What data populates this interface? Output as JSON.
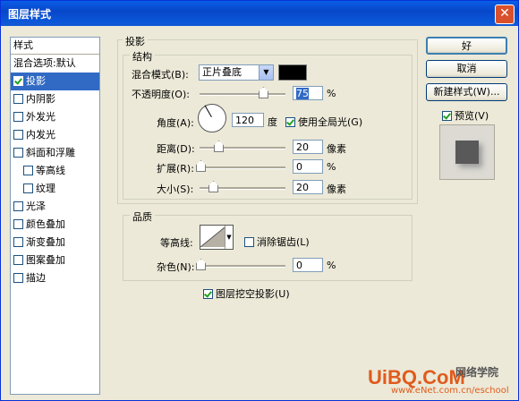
{
  "window": {
    "title": "图层样式",
    "close_label": "✕"
  },
  "sidebar": {
    "header": "样式",
    "items": [
      {
        "label": "混合选项:默认",
        "checkbox": false,
        "checked": false,
        "sub": false,
        "selected": false
      },
      {
        "label": "投影",
        "checkbox": true,
        "checked": true,
        "sub": false,
        "selected": true
      },
      {
        "label": "内阴影",
        "checkbox": true,
        "checked": false,
        "sub": false,
        "selected": false
      },
      {
        "label": "外发光",
        "checkbox": true,
        "checked": false,
        "sub": false,
        "selected": false
      },
      {
        "label": "内发光",
        "checkbox": true,
        "checked": false,
        "sub": false,
        "selected": false
      },
      {
        "label": "斜面和浮雕",
        "checkbox": true,
        "checked": false,
        "sub": false,
        "selected": false
      },
      {
        "label": "等高线",
        "checkbox": true,
        "checked": false,
        "sub": true,
        "selected": false
      },
      {
        "label": "纹理",
        "checkbox": true,
        "checked": false,
        "sub": true,
        "selected": false
      },
      {
        "label": "光泽",
        "checkbox": true,
        "checked": false,
        "sub": false,
        "selected": false
      },
      {
        "label": "颜色叠加",
        "checkbox": true,
        "checked": false,
        "sub": false,
        "selected": false
      },
      {
        "label": "渐变叠加",
        "checkbox": true,
        "checked": false,
        "sub": false,
        "selected": false
      },
      {
        "label": "图案叠加",
        "checkbox": true,
        "checked": false,
        "sub": false,
        "selected": false
      },
      {
        "label": "描边",
        "checkbox": true,
        "checked": false,
        "sub": false,
        "selected": false
      }
    ]
  },
  "shadow": {
    "group_title": "投影",
    "structure_title": "结构",
    "blend_mode_label": "混合模式(B):",
    "blend_mode_value": "正片叠底",
    "blend_color": "#000000",
    "opacity_label": "不透明度(O):",
    "opacity_value": "75",
    "opacity_unit": "%",
    "angle_label": "角度(A):",
    "angle_value": "120",
    "angle_unit": "度",
    "global_light_label": "使用全局光(G)",
    "global_light_checked": true,
    "distance_label": "距离(D):",
    "distance_value": "20",
    "distance_unit": "像素",
    "spread_label": "扩展(R):",
    "spread_value": "0",
    "spread_unit": "%",
    "size_label": "大小(S):",
    "size_value": "20",
    "size_unit": "像素"
  },
  "quality": {
    "title": "品质",
    "contour_label": "等高线:",
    "antialias_label": "消除锯齿(L)",
    "antialias_checked": false,
    "noise_label": "杂色(N):",
    "noise_value": "0",
    "noise_unit": "%",
    "knockout_label": "图层挖空投影(U)",
    "knockout_checked": true
  },
  "buttons": {
    "ok": "好",
    "cancel": "取消",
    "new_style": "新建样式(W)...",
    "preview": "预览(V)",
    "preview_checked": true
  },
  "watermark": {
    "logo": "UiBQ.CoM",
    "site": "www.eNet.com.cn/eschool",
    "tag": "网络学院"
  },
  "colors": {
    "accent": "#316ac5",
    "title_bar": "#0a5ee6"
  }
}
